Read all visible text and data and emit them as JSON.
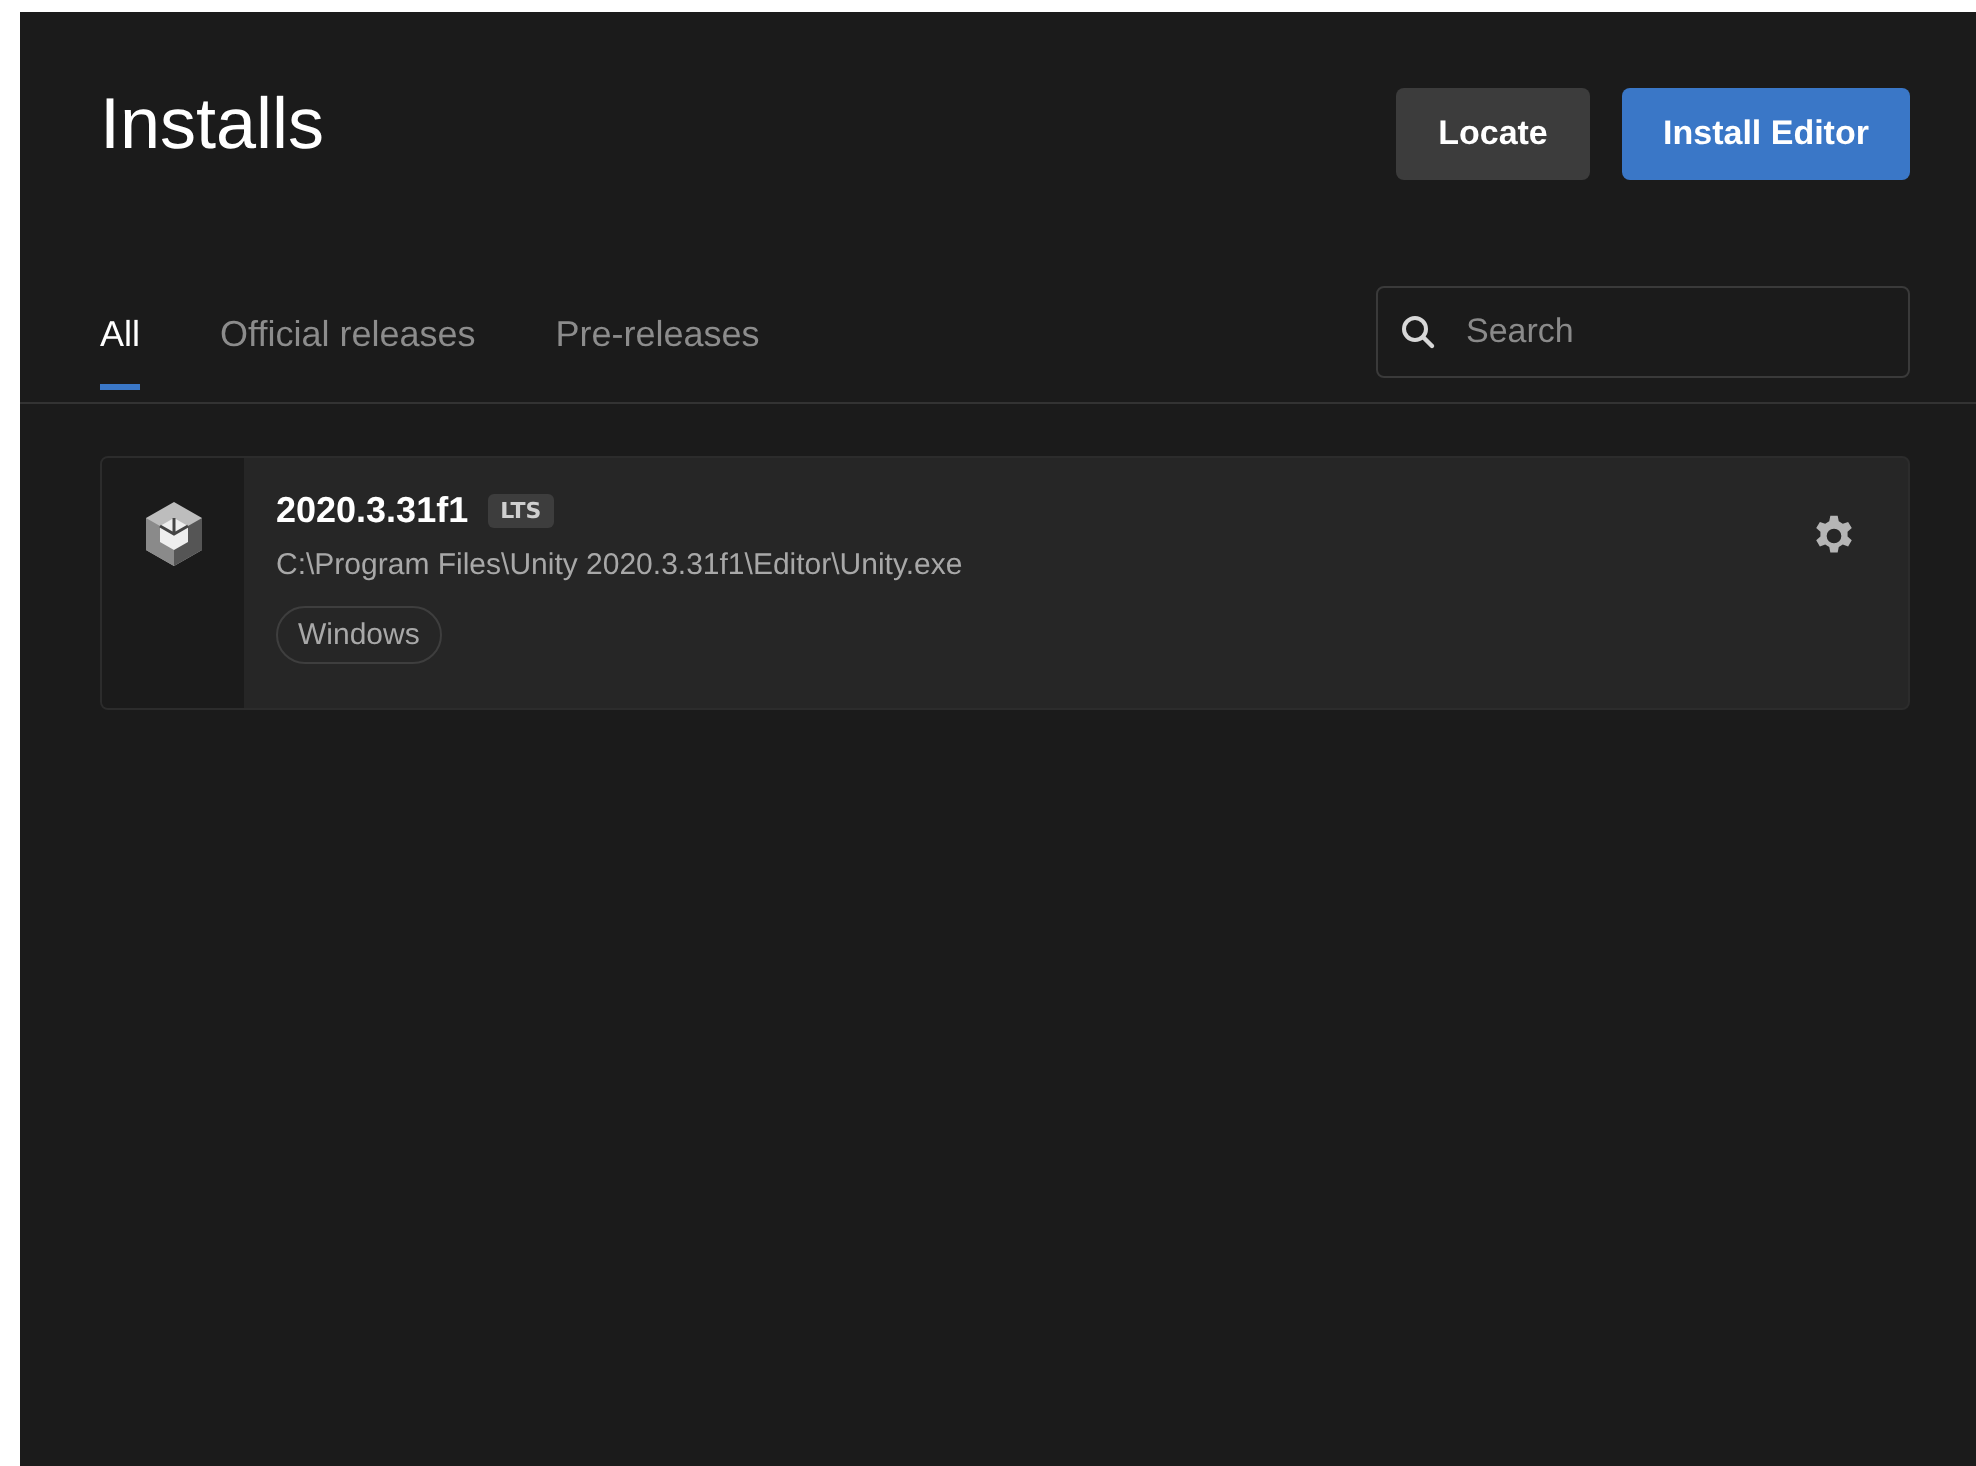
{
  "title": "Installs",
  "buttons": [
    {
      "label": "Locate",
      "kind": "secondary"
    },
    {
      "label": "Install Editor",
      "kind": "primary"
    }
  ],
  "tabs": [
    {
      "label": "All",
      "selected": true
    },
    {
      "label": "Official releases",
      "selected": false
    },
    {
      "label": "Pre-releases",
      "selected": false
    }
  ],
  "search": {
    "placeholder": "Search"
  },
  "installs": [
    {
      "version": "2020.3.31f1",
      "badge": "LTS",
      "path": "C:\\Program Files\\Unity 2020.3.31f1\\Editor\\Unity.exe",
      "tags": [
        "Windows"
      ]
    }
  ]
}
